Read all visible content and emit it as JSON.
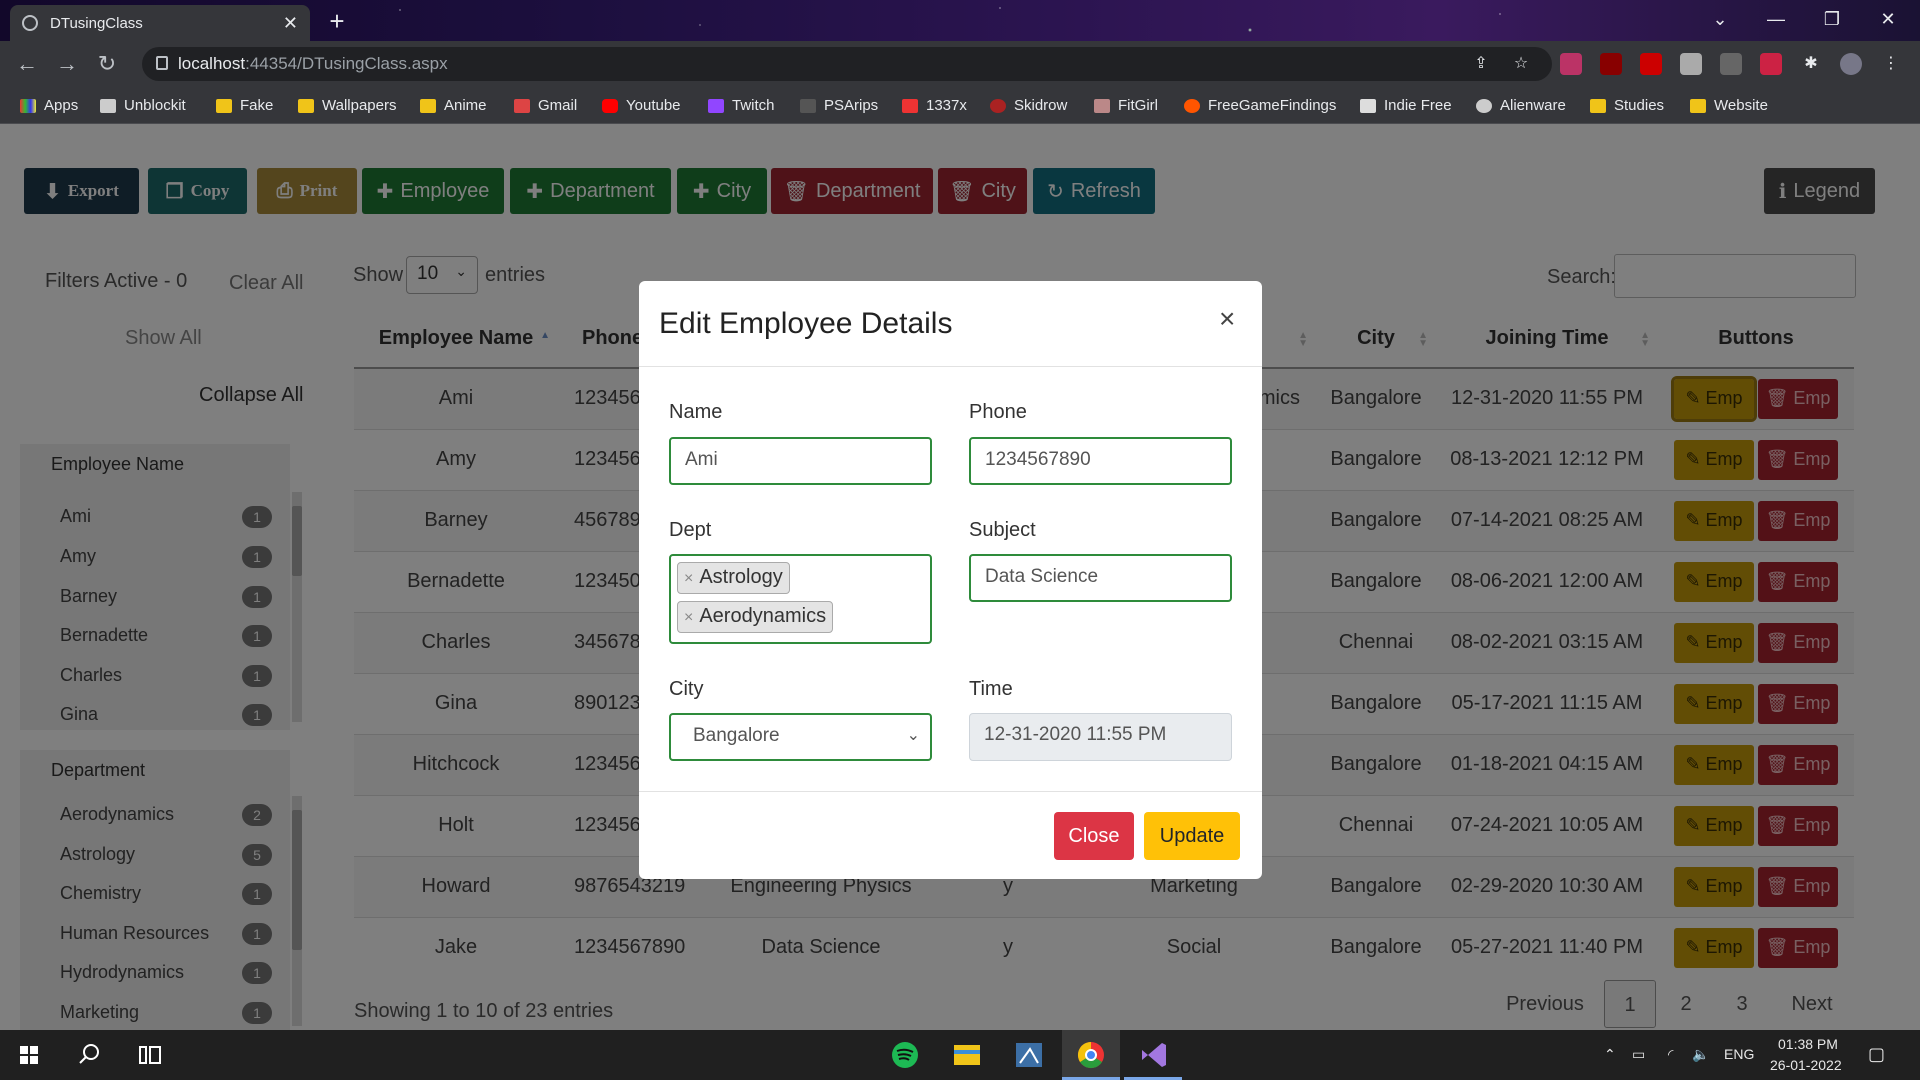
{
  "browser": {
    "tab_title": "DTusingClass",
    "url_host": "localhost",
    "url_rest": ":44354/DTusingClass.aspx",
    "bookmarks": [
      "Apps",
      "Unblockit",
      "Fake",
      "Wallpapers",
      "Anime",
      "Gmail",
      "Youtube",
      "Twitch",
      "PSArips",
      "1337x",
      "Skidrow",
      "FitGirl",
      "FreeGameFindings",
      "Indie Free",
      "Alienware",
      "Studies",
      "Website"
    ]
  },
  "toolbar": {
    "export": "Export",
    "copy": "Copy",
    "print": "Print",
    "add_employee": "Employee",
    "add_department": "Department",
    "add_city": "City",
    "del_department": "Department",
    "del_city": "City",
    "refresh": "Refresh",
    "legend": "Legend"
  },
  "sidebar": {
    "filters_active": "Filters Active - 0",
    "clear_all": "Clear All",
    "show_all": "Show All",
    "collapse_all": "Collapse All",
    "employee_filter": {
      "title": "Employee Name",
      "items": [
        {
          "label": "Ami",
          "count": "1"
        },
        {
          "label": "Amy",
          "count": "1"
        },
        {
          "label": "Barney",
          "count": "1"
        },
        {
          "label": "Bernadette",
          "count": "1"
        },
        {
          "label": "Charles",
          "count": "1"
        },
        {
          "label": "Gina",
          "count": "1"
        }
      ]
    },
    "department_filter": {
      "title": "Department",
      "items": [
        {
          "label": "Aerodynamics",
          "count": "2"
        },
        {
          "label": "Astrology",
          "count": "5"
        },
        {
          "label": "Chemistry",
          "count": "1"
        },
        {
          "label": "Human Resources",
          "count": "1"
        },
        {
          "label": "Hydrodynamics",
          "count": "1"
        },
        {
          "label": "Marketing",
          "count": "1"
        }
      ]
    }
  },
  "table_controls": {
    "show": "Show",
    "length": "10",
    "entries": "entries",
    "search_label": "Search:"
  },
  "table": {
    "headers": [
      "Employee Name",
      "Phone",
      "",
      "",
      "",
      "City",
      "Joining Time",
      "Buttons"
    ],
    "edit_label": "Emp",
    "delete_label": "Emp",
    "rows": [
      {
        "name": "Ami",
        "phone": "123456",
        "dept": "",
        "flag": "",
        "subject": "mics",
        "city": "Bangalore",
        "time": "12-31-2020 11:55 PM"
      },
      {
        "name": "Amy",
        "phone": "123456",
        "dept": "",
        "flag": "",
        "subject": "",
        "city": "Bangalore",
        "time": "08-13-2021 12:12 PM"
      },
      {
        "name": "Barney",
        "phone": "456789",
        "dept": "",
        "flag": "",
        "subject": "",
        "city": "Bangalore",
        "time": "07-14-2021 08:25 AM"
      },
      {
        "name": "Bernadette",
        "phone": "123450",
        "dept": "",
        "flag": "",
        "subject": "",
        "city": "Bangalore",
        "time": "08-06-2021 12:00 AM"
      },
      {
        "name": "Charles",
        "phone": "345678",
        "dept": "",
        "flag": "",
        "subject": "",
        "city": "Chennai",
        "time": "08-02-2021 03:15 AM"
      },
      {
        "name": "Gina",
        "phone": "890123",
        "dept": "",
        "flag": "",
        "subject": "",
        "city": "Bangalore",
        "time": "05-17-2021 11:15 AM"
      },
      {
        "name": "Hitchcock",
        "phone": "123456",
        "dept": "",
        "flag": "",
        "subject": "",
        "city": "Bangalore",
        "time": "01-18-2021 04:15 AM"
      },
      {
        "name": "Holt",
        "phone": "123456",
        "dept": "",
        "flag": "",
        "subject": "",
        "city": "Chennai",
        "time": "07-24-2021 10:05 AM"
      },
      {
        "name": "Howard",
        "phone": "9876543219",
        "dept": "Engineering Physics",
        "flag": "y",
        "subject": "Marketing",
        "city": "Bangalore",
        "time": "02-29-2020 10:30 AM"
      },
      {
        "name": "Jake",
        "phone": "1234567890",
        "dept": "Data Science",
        "flag": "y",
        "subject": "Social",
        "city": "Bangalore",
        "time": "05-27-2021 11:40 PM"
      }
    ],
    "info": "Showing 1 to 10 of 23 entries",
    "pager": {
      "previous": "Previous",
      "pages": [
        "1",
        "2",
        "3"
      ],
      "next": "Next"
    }
  },
  "modal": {
    "title": "Edit Employee Details",
    "close_x": "×",
    "name_label": "Name",
    "name_value": "Ami",
    "phone_label": "Phone",
    "phone_value": "1234567890",
    "dept_label": "Dept",
    "dept_chips": [
      "Astrology",
      "Aerodynamics"
    ],
    "subject_label": "Subject",
    "subject_value": "Data Science",
    "city_label": "City",
    "city_value": "Bangalore",
    "time_label": "Time",
    "time_value": "12-31-2020 11:55 PM",
    "close_button": "Close",
    "update_button": "Update"
  },
  "taskbar": {
    "lang": "ENG",
    "time": "01:38 PM",
    "date": "26-01-2022"
  },
  "colors": {
    "export": "#1e3a4c",
    "copy": "#1d6b6b",
    "print": "#a88a3a",
    "add": "#1f7a35",
    "delete": "#9e2430",
    "refresh": "#136e80",
    "legend": "#4a4a4a",
    "close": "#dc3545",
    "update": "#ffc107"
  }
}
